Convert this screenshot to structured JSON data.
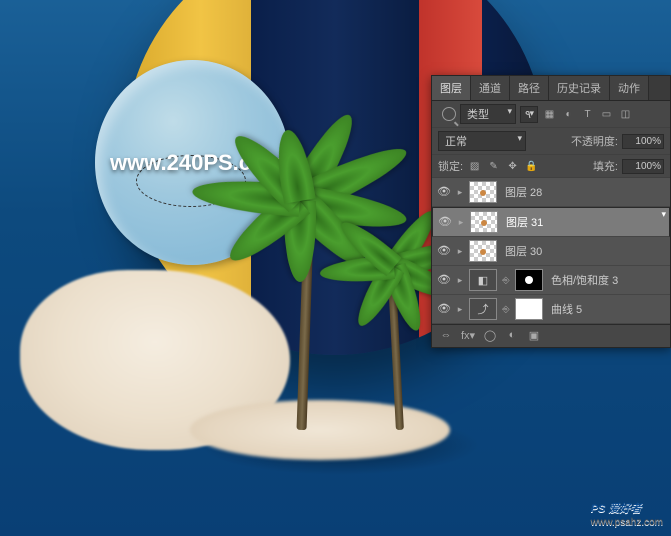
{
  "watermark": "www.240PS.com",
  "brand": {
    "name": "PS 爱好者",
    "url": "www.psahz.com"
  },
  "panel": {
    "tabs": [
      "图层",
      "通道",
      "路径",
      "历史记录",
      "动作"
    ],
    "active_tab": 0,
    "filter_label": "类型",
    "blend_mode": "正常",
    "opacity_label": "不透明度:",
    "opacity_value": "100%",
    "lock_label": "锁定:",
    "fill_label": "填充:",
    "fill_value": "100%",
    "layers": [
      {
        "visible": true,
        "type": "pixel",
        "name": "图层 28",
        "selected": false
      },
      {
        "visible": true,
        "type": "pixel",
        "name": "图层 31",
        "selected": true
      },
      {
        "visible": true,
        "type": "pixel",
        "name": "图层 30",
        "selected": false
      },
      {
        "visible": true,
        "type": "adjust",
        "name": "色相/饱和度 3",
        "selected": false,
        "adjust_icon": "◧"
      },
      {
        "visible": true,
        "type": "curves",
        "name": "曲线 5",
        "selected": false,
        "adjust_icon": "⤴"
      }
    ]
  }
}
